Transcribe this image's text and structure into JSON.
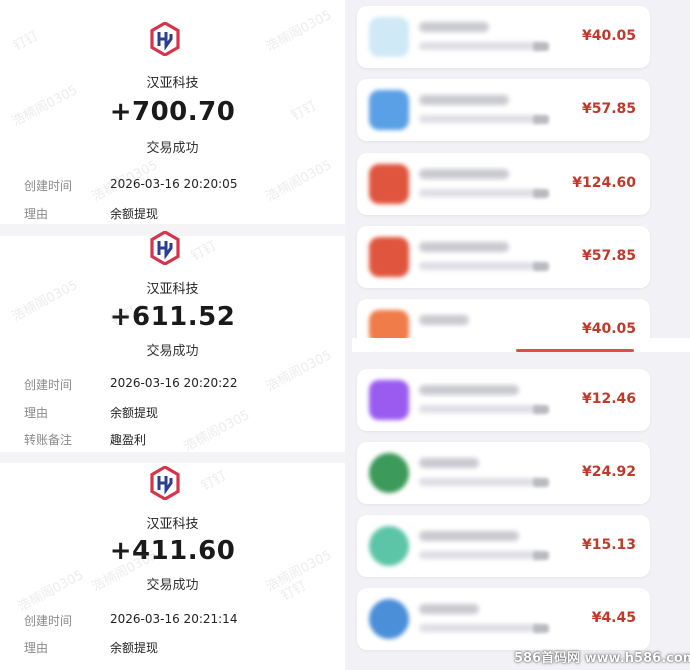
{
  "receipts": [
    {
      "merchant": "汉亚科技",
      "amount": "+700.70",
      "status": "交易成功",
      "rows": [
        {
          "label": "创建时间",
          "value": "2026-03-16 20:20:05"
        },
        {
          "label": "理由",
          "value": "余额提现"
        }
      ]
    },
    {
      "merchant": "汉亚科技",
      "amount": "+611.52",
      "status": "交易成功",
      "rows": [
        {
          "label": "创建时间",
          "value": "2026-03-16 20:20:22"
        },
        {
          "label": "理由",
          "value": "余额提现"
        },
        {
          "label": "转账备注",
          "value": "趣盈利"
        }
      ]
    },
    {
      "merchant": "汉亚科技",
      "amount": "+411.60",
      "status": "交易成功",
      "rows": [
        {
          "label": "创建时间",
          "value": "2026-03-16 20:21:14"
        },
        {
          "label": "理由",
          "value": "余额提现"
        }
      ]
    }
  ],
  "watermark_text": "浩楠阁0305",
  "watermark_text_2": "钉钉",
  "orders": [
    {
      "price": "¥40.05",
      "thumb_color": "#cfe9f6"
    },
    {
      "price": "¥57.85",
      "thumb_color": "#5aa0e6"
    },
    {
      "price": "¥124.60",
      "thumb_color": "#e0553e"
    },
    {
      "price": "¥57.85",
      "thumb_color": "#e0553e"
    },
    {
      "price": "¥40.05",
      "thumb_color": "#f07c4a"
    },
    {
      "price": "¥12.46",
      "thumb_color": "#9a5cf0"
    },
    {
      "price": "¥24.92",
      "thumb_color": "#3c9a5a"
    },
    {
      "price": "¥15.13",
      "thumb_color": "#5cc5a8"
    },
    {
      "price": "¥4.45",
      "thumb_color": "#4a8fd8"
    }
  ],
  "colors": {
    "price": "#c0392b",
    "logo_red": "#d6344a",
    "logo_blue": "#2a3f8f"
  },
  "footer_watermark": "586首码网 www.h586.com"
}
